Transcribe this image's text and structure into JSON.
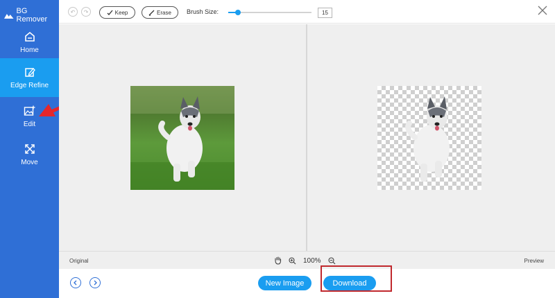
{
  "app": {
    "title": "BG Remover"
  },
  "sidebar": {
    "items": [
      {
        "label": "Home",
        "icon": "home-icon",
        "active": false
      },
      {
        "label": "Edge Refine",
        "icon": "edge-refine-icon",
        "active": true
      },
      {
        "label": "Edit",
        "icon": "edit-image-icon",
        "active": false
      },
      {
        "label": "Move",
        "icon": "move-icon",
        "active": false
      }
    ]
  },
  "toolbar": {
    "undo_icon": "undo-icon",
    "redo_icon": "redo-icon",
    "keep_label": "Keep",
    "erase_label": "Erase",
    "brush_size_label": "Brush Size:",
    "brush_size_value": "15",
    "brush_size_fraction": 0.12,
    "close_icon": "close-icon"
  },
  "panels": {
    "original_label": "Original",
    "preview_label": "Preview"
  },
  "zoom": {
    "value": "100%"
  },
  "bottom": {
    "new_image_label": "New Image",
    "download_label": "Download"
  },
  "colors": {
    "sidebar": "#2f6fd6",
    "active": "#1a9df0",
    "accent": "#1a9df0",
    "highlight": "#c0282d"
  }
}
